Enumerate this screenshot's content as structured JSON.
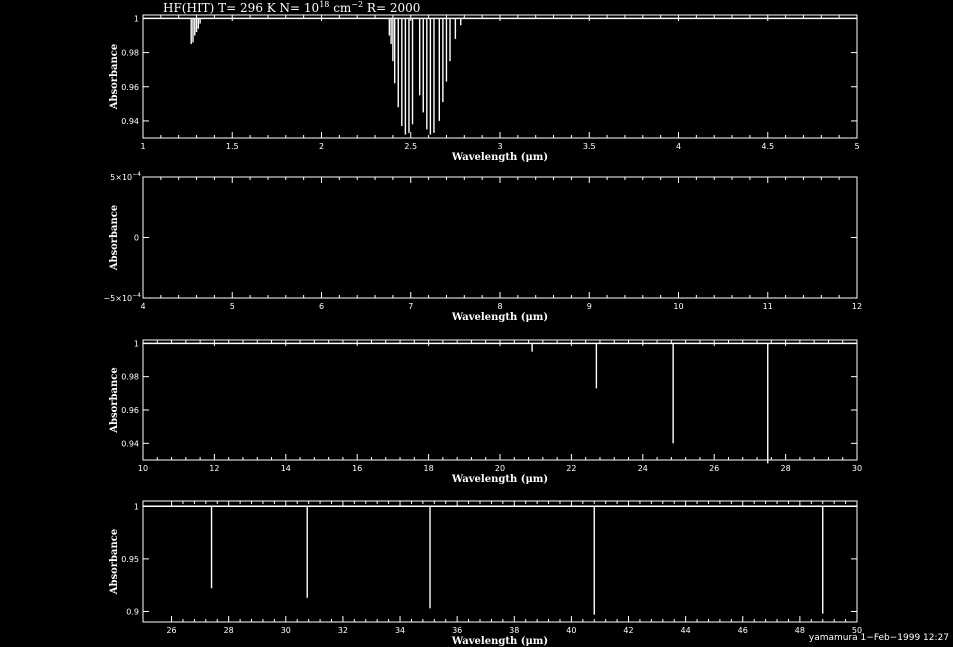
{
  "title": "HF(HIT) T= 296 K N= 10",
  "title_exp": "18",
  "title_mid": " cm",
  "title_exp2": "−2",
  "title_end": " R= 2000",
  "footer": "yamamura  1−Feb−1999 12:27",
  "colors": {
    "background": "#000000",
    "foreground": "#ffffff"
  },
  "chart_data": [
    {
      "type": "line",
      "xlabel": "Wavelength (μm)",
      "ylabel": "Absorbance",
      "xlim": [
        1,
        5
      ],
      "ylim": [
        0.93,
        1.002
      ],
      "xticks": [
        "1",
        "1.5",
        "2",
        "2.5",
        "3",
        "3.5",
        "4",
        "4.5",
        "5"
      ],
      "yticks": [
        "0.94",
        "0.96",
        "0.98",
        "1"
      ],
      "yticks_values": [
        0.94,
        0.96,
        0.98,
        1
      ],
      "lines": [
        {
          "x": 1.27,
          "y": 0.985
        },
        {
          "x": 1.28,
          "y": 0.986
        },
        {
          "x": 1.29,
          "y": 0.99
        },
        {
          "x": 1.3,
          "y": 0.992
        },
        {
          "x": 1.31,
          "y": 0.994
        },
        {
          "x": 1.32,
          "y": 0.997
        },
        {
          "x": 2.38,
          "y": 0.99
        },
        {
          "x": 2.39,
          "y": 0.985
        },
        {
          "x": 2.4,
          "y": 0.975
        },
        {
          "x": 2.41,
          "y": 0.962
        },
        {
          "x": 2.43,
          "y": 0.948
        },
        {
          "x": 2.45,
          "y": 0.937
        },
        {
          "x": 2.47,
          "y": 0.932
        },
        {
          "x": 2.49,
          "y": 0.933
        },
        {
          "x": 2.51,
          "y": 0.938
        },
        {
          "x": 2.55,
          "y": 0.955
        },
        {
          "x": 2.57,
          "y": 0.945
        },
        {
          "x": 2.59,
          "y": 0.935
        },
        {
          "x": 2.61,
          "y": 0.932
        },
        {
          "x": 2.63,
          "y": 0.933
        },
        {
          "x": 2.66,
          "y": 0.94
        },
        {
          "x": 2.68,
          "y": 0.951
        },
        {
          "x": 2.7,
          "y": 0.963
        },
        {
          "x": 2.72,
          "y": 0.975
        },
        {
          "x": 2.75,
          "y": 0.988
        },
        {
          "x": 2.78,
          "y": 0.996
        }
      ]
    },
    {
      "type": "line",
      "xlabel": "Wavelength (μm)",
      "ylabel": "Absorbance",
      "xlim": [
        4,
        12
      ],
      "ylim": [
        -0.0005,
        0.0005
      ],
      "xticks": [
        "4",
        "5",
        "6",
        "7",
        "8",
        "9",
        "10",
        "11",
        "12"
      ],
      "yticks": [
        "−5×10",
        "0",
        "5×10"
      ],
      "yticks_exp": [
        "−4",
        "",
        "−4"
      ],
      "yticks_values": [
        -0.0005,
        0,
        0.0005
      ],
      "lines": []
    },
    {
      "type": "line",
      "xlabel": "Wavelength (μm)",
      "ylabel": "Absorbance",
      "xlim": [
        10,
        30
      ],
      "ylim": [
        0.93,
        1.002
      ],
      "xticks": [
        "10",
        "12",
        "14",
        "16",
        "18",
        "20",
        "22",
        "24",
        "26",
        "28",
        "30"
      ],
      "yticks": [
        "0.94",
        "0.96",
        "0.98",
        "1"
      ],
      "yticks_values": [
        0.94,
        0.96,
        0.98,
        1
      ],
      "lines": [
        {
          "x": 18.9,
          "y": 0.9995
        },
        {
          "x": 20.9,
          "y": 0.995
        },
        {
          "x": 22.7,
          "y": 0.973
        },
        {
          "x": 24.85,
          "y": 0.94
        },
        {
          "x": 27.5,
          "y": 0.928
        }
      ]
    },
    {
      "type": "line",
      "xlabel": "Wavelength (μm)",
      "ylabel": "Absorbance",
      "xlim": [
        25,
        50
      ],
      "ylim": [
        0.89,
        1.005
      ],
      "xticks": [
        "26",
        "28",
        "30",
        "32",
        "34",
        "36",
        "38",
        "40",
        "42",
        "44",
        "46",
        "48",
        "50"
      ],
      "yticks": [
        "0.9",
        "0.95",
        "1"
      ],
      "yticks_values": [
        0.9,
        0.95,
        1
      ],
      "lines": [
        {
          "x": 27.4,
          "y": 0.922
        },
        {
          "x": 30.75,
          "y": 0.913
        },
        {
          "x": 35.05,
          "y": 0.903
        },
        {
          "x": 40.8,
          "y": 0.897
        },
        {
          "x": 48.8,
          "y": 0.898
        }
      ]
    }
  ]
}
